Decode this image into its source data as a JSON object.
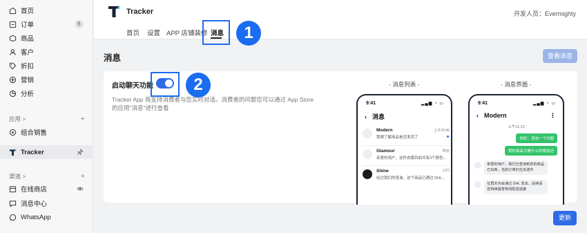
{
  "sidebar": {
    "items": [
      {
        "label": "首页",
        "icon": "home-icon"
      },
      {
        "label": "订单",
        "icon": "orders-icon",
        "badge": "6"
      },
      {
        "label": "商品",
        "icon": "products-icon"
      },
      {
        "label": "客户",
        "icon": "customer-icon"
      },
      {
        "label": "折扣",
        "icon": "discount-tag-icon"
      },
      {
        "label": "营销",
        "icon": "marketing-icon"
      },
      {
        "label": "分析",
        "icon": "analytics-icon"
      }
    ],
    "apps_section": {
      "label": "应用 >",
      "plus": "+"
    },
    "app_items": [
      {
        "label": "组合销售",
        "icon": "bundle-icon"
      }
    ],
    "active_app": {
      "label": "Tracker",
      "icon": "tracker-logo-icon",
      "pin_icon": "pin-icon"
    },
    "channels_section": {
      "label": "渠道 >",
      "plus": "+"
    },
    "channel_items": [
      {
        "label": "在线商店",
        "icon": "store-icon",
        "right_icon": "eye-icon"
      },
      {
        "label": "消息中心",
        "icon": "chat-icon"
      },
      {
        "label": "WhatsApp",
        "icon": "whatsapp-icon"
      }
    ]
  },
  "header": {
    "app_title": "Tracker",
    "developer": "开发人员：Evermighty",
    "tabs": [
      {
        "label": "首页"
      },
      {
        "label": "设置"
      },
      {
        "label": "APP 店铺装修"
      },
      {
        "label": "消息",
        "active": true
      }
    ]
  },
  "annotations": {
    "one": "1",
    "two": "2",
    "color": "#1a6cf0"
  },
  "page": {
    "title": "消息",
    "view_messages_button": "查看消息",
    "update_button": "更新"
  },
  "card": {
    "title": "启动聊天功能",
    "toggle_on": true,
    "description": "Tracker App 将支持消费者与您实时对话。消费者的问题您可以通过 App Store 的应用\"消息\"进行查看",
    "preview_list_label": "- 消息列表 -",
    "preview_chat_label": "- 消息界面 -"
  },
  "phone_list": {
    "time": "9:41",
    "status_icons": "▂▄▆ ◔ ▭",
    "back": "‹",
    "title": "消息",
    "conversations": [
      {
        "name": "Modern",
        "time": "上午10:45",
        "message": "我想了解商品是否发货了",
        "unread": true,
        "avatar_label": "MODERN"
      },
      {
        "name": "Glamour",
        "time": "昨天",
        "message": "亲爱的用户，这件衣服目前共有3个颜色...",
        "unread": false,
        "avatar_label": "Glamour"
      },
      {
        "name": "Shine",
        "time": "1/27",
        "message": "经过我们的查询，这个商品已通过 DHL...",
        "unread": false,
        "avatar_label": "SHINE"
      }
    ]
  },
  "phone_chat": {
    "time": "9:41",
    "status_icons": "▂▄▆ ◔ ▭",
    "back": "‹",
    "title": "Modern",
    "more": "⋮",
    "chat_time": "上午11:23",
    "messages": [
      {
        "side": "right",
        "text": "你好，咨询一个问题"
      },
      {
        "side": "right",
        "text": "我的商品大概什么时候送达"
      },
      {
        "side": "left",
        "text": "亲爱的用户，我们已查询到您的商品已出库，当前订单仍在派送中"
      },
      {
        "side": "left",
        "text": "在再天内会通过 DHL 发出，后续请您持续留意物流配送进度"
      }
    ]
  },
  "colors": {
    "accent": "#2e6be6",
    "accent_light": "#9bb5e8",
    "bubble_green": "#34c36b"
  }
}
